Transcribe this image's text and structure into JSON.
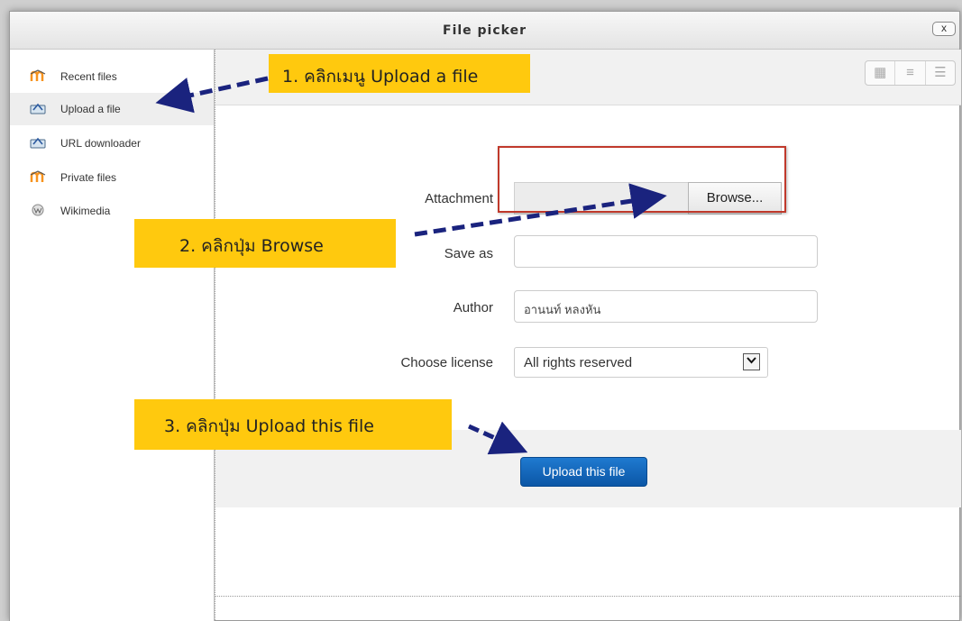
{
  "window": {
    "title": "File picker",
    "close_label": "x"
  },
  "sidebar": {
    "items": [
      {
        "label": "Recent files",
        "icon": "moodle-icon"
      },
      {
        "label": "Upload a file",
        "icon": "upload-icon"
      },
      {
        "label": "URL downloader",
        "icon": "upload-icon"
      },
      {
        "label": "Private files",
        "icon": "moodle-icon"
      },
      {
        "label": "Wikimedia",
        "icon": "wikimedia-icon"
      }
    ]
  },
  "toolbar": {
    "view_buttons": [
      "grid-view-icon",
      "list-view-icon",
      "tree-view-icon"
    ]
  },
  "form": {
    "attachment_label": "Attachment",
    "browse_label": "Browse...",
    "save_as_label": "Save as",
    "save_as_value": "",
    "author_label": "Author",
    "author_value": "อานนท์ หลงหัน",
    "license_label": "Choose license",
    "license_value": "All rights reserved",
    "upload_button": "Upload this file"
  },
  "callouts": {
    "step1": "1. คลิกเมนู Upload a file",
    "step2": "2. คลิกปุ่ม Browse",
    "step3": "3. คลิกปุ่ม Upload this file"
  },
  "colors": {
    "callout": "#ffc90e",
    "arrow": "#1a237e",
    "highlight": "#c0392b",
    "primary_button": "#0b56a6"
  }
}
